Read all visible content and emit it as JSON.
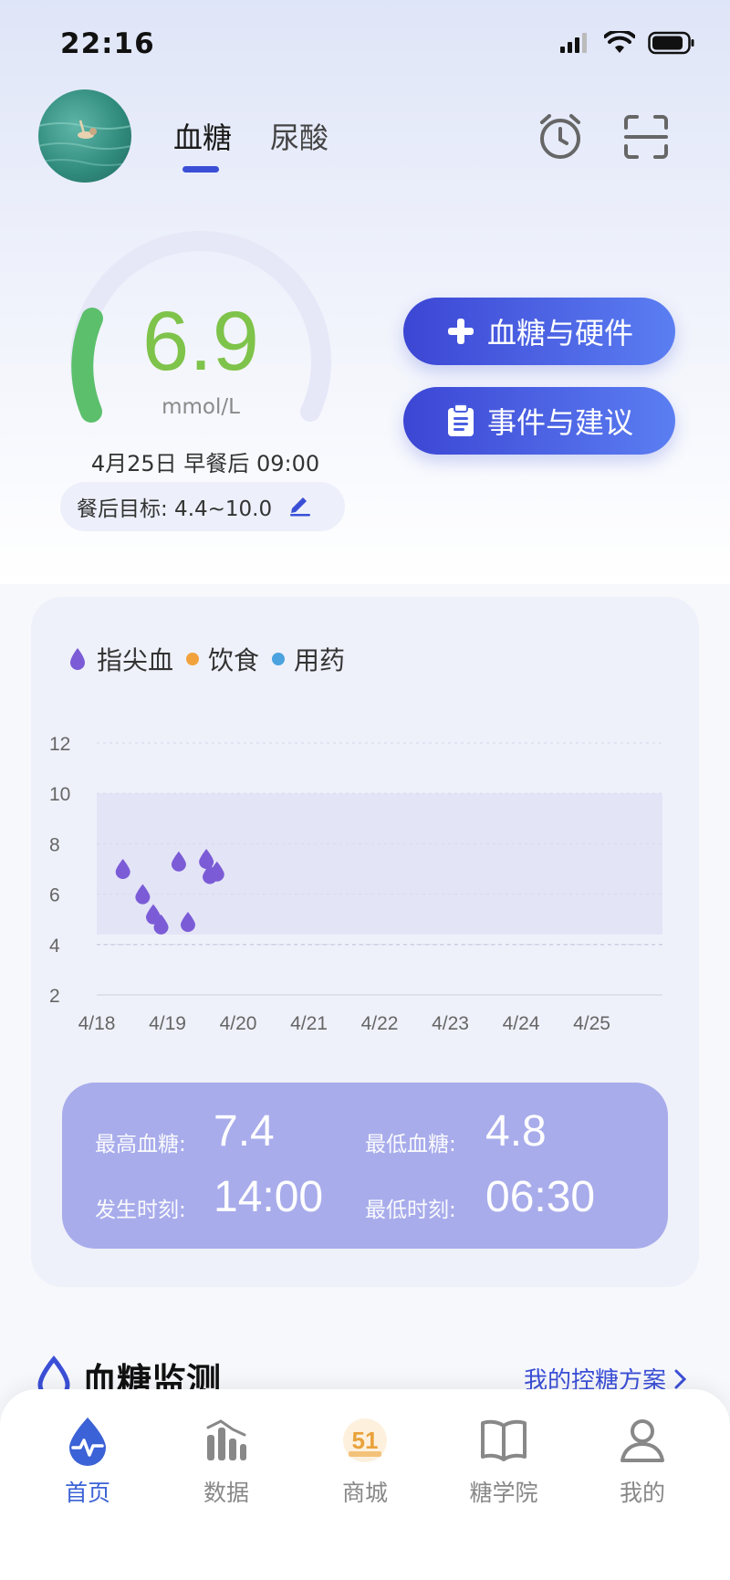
{
  "status_bar": {
    "time": "22:16"
  },
  "header": {
    "tabs": [
      {
        "label": "血糖",
        "active": true
      },
      {
        "label": "尿酸",
        "active": false
      }
    ]
  },
  "gauge": {
    "value": "6.9",
    "unit": "mmol/L",
    "reading_time": "4月25日 早餐后 09:00",
    "target_label": "餐后目标: 4.4~10.0",
    "value_color": "#7ec34a"
  },
  "actions": {
    "glucose_hardware": "血糖与硬件",
    "events_advice": "事件与建议"
  },
  "legend": [
    {
      "label": "指尖血",
      "color": "#7b5cd6",
      "icon": "blood-drop-icon"
    },
    {
      "label": "饮食",
      "color": "#f2a23c"
    },
    {
      "label": "用药",
      "color": "#4aa3df"
    }
  ],
  "chart_data": {
    "type": "scatter",
    "y_ticks": [
      "12",
      "10",
      "8",
      "6",
      "4",
      "2"
    ],
    "x_ticks": [
      "4/18",
      "4/19",
      "4/20",
      "4/21",
      "4/22",
      "4/23",
      "4/24",
      "4/25"
    ],
    "ylim": [
      2,
      12
    ],
    "target_band": [
      4.4,
      10
    ],
    "series": [
      {
        "points": [
          {
            "x": 4.37,
            "y": 7.0
          },
          {
            "x": 4.65,
            "y": 6.0
          },
          {
            "x": 4.8,
            "y": 5.2
          },
          {
            "x": 4.91,
            "y": 4.8
          },
          {
            "x": 5.16,
            "y": 7.3
          },
          {
            "x": 5.29,
            "y": 4.9
          },
          {
            "x": 5.55,
            "y": 7.4
          },
          {
            "x": 5.6,
            "y": 6.8
          },
          {
            "x": 5.7,
            "y": 6.9
          }
        ]
      }
    ]
  },
  "stats": {
    "max_label": "最高血糖:",
    "max_value": "7.4",
    "min_label": "最低血糖:",
    "min_value": "4.8",
    "max_time_label": "发生时刻:",
    "max_time_value": "14:00",
    "min_time_label": "最低时刻:",
    "min_time_value": "06:30"
  },
  "section": {
    "title": "血糖监测",
    "link": "我的控糖方案"
  },
  "tabbar": [
    {
      "label": "首页",
      "icon": "home-drop-icon",
      "active": true
    },
    {
      "label": "数据",
      "icon": "data-chart-icon",
      "active": false
    },
    {
      "label": "商城",
      "icon": "mall-51-icon",
      "active": false
    },
    {
      "label": "糖学院",
      "icon": "book-icon",
      "active": false
    },
    {
      "label": "我的",
      "icon": "user-icon",
      "active": false
    }
  ]
}
